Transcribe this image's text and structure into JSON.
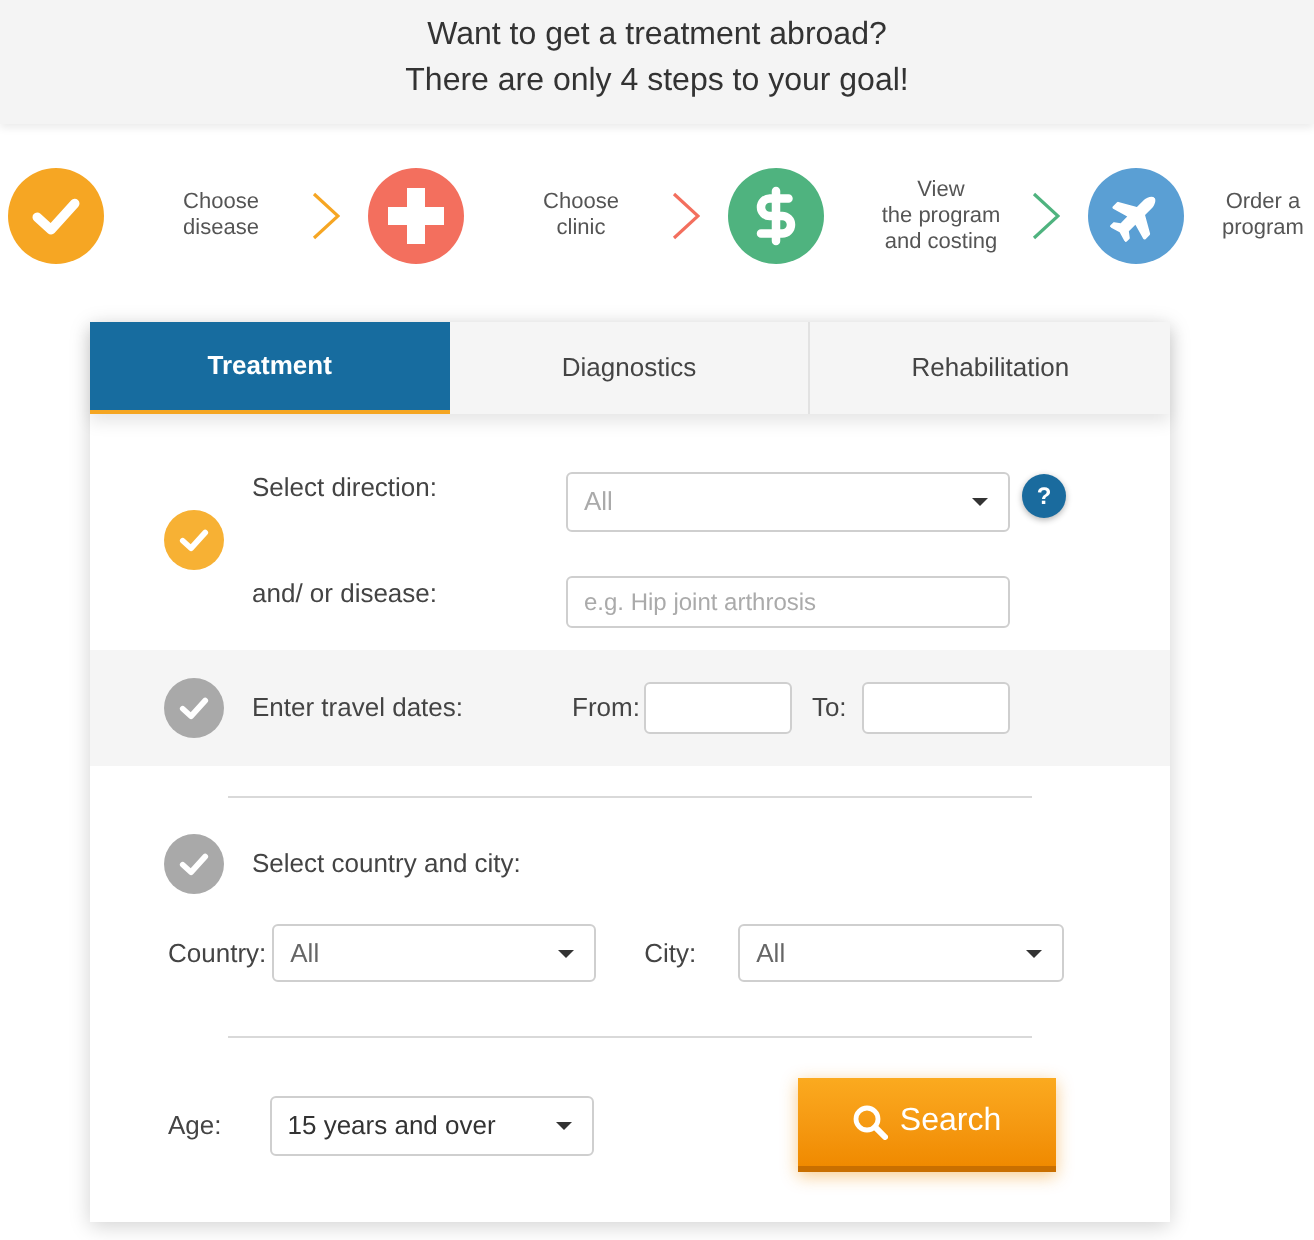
{
  "header": {
    "title": "Want to get a treatment abroad?\nThere are only 4 steps to your goal!"
  },
  "steps": [
    {
      "label": "Choose\ndisease",
      "color": "#f6a623"
    },
    {
      "label": "Choose\nclinic",
      "color": "#f36f5e"
    },
    {
      "label": "View\nthe program\nand costing",
      "color": "#4fb37f"
    },
    {
      "label": "Order a\nprogram",
      "color": "#5a9fd4"
    }
  ],
  "tabs": [
    {
      "label": "Treatment",
      "selected": true
    },
    {
      "label": "Diagnostics",
      "selected": false
    },
    {
      "label": "Rehabilitation",
      "selected": false
    }
  ],
  "sections": [
    {
      "kind": "direction",
      "color": "#f7b134",
      "label": "Select direction:",
      "value": "All",
      "help": "?",
      "disease_label": "and/ or disease:",
      "disease_placeholder": "e.g. Hip joint arthrosis"
    },
    {
      "kind": "dates",
      "color": "#a9a9a9",
      "label": "Enter travel dates:",
      "from_label": "From:",
      "to_label": "To:"
    },
    {
      "kind": "location",
      "color": "#a9a9a9",
      "label": "Select country and city:",
      "country_label": "Country:",
      "country_value": "All",
      "city_label": "City:",
      "city_value": "All"
    }
  ],
  "age": {
    "label": "Age:",
    "value": "15 years and over"
  },
  "search_button": {
    "label": "Search"
  }
}
